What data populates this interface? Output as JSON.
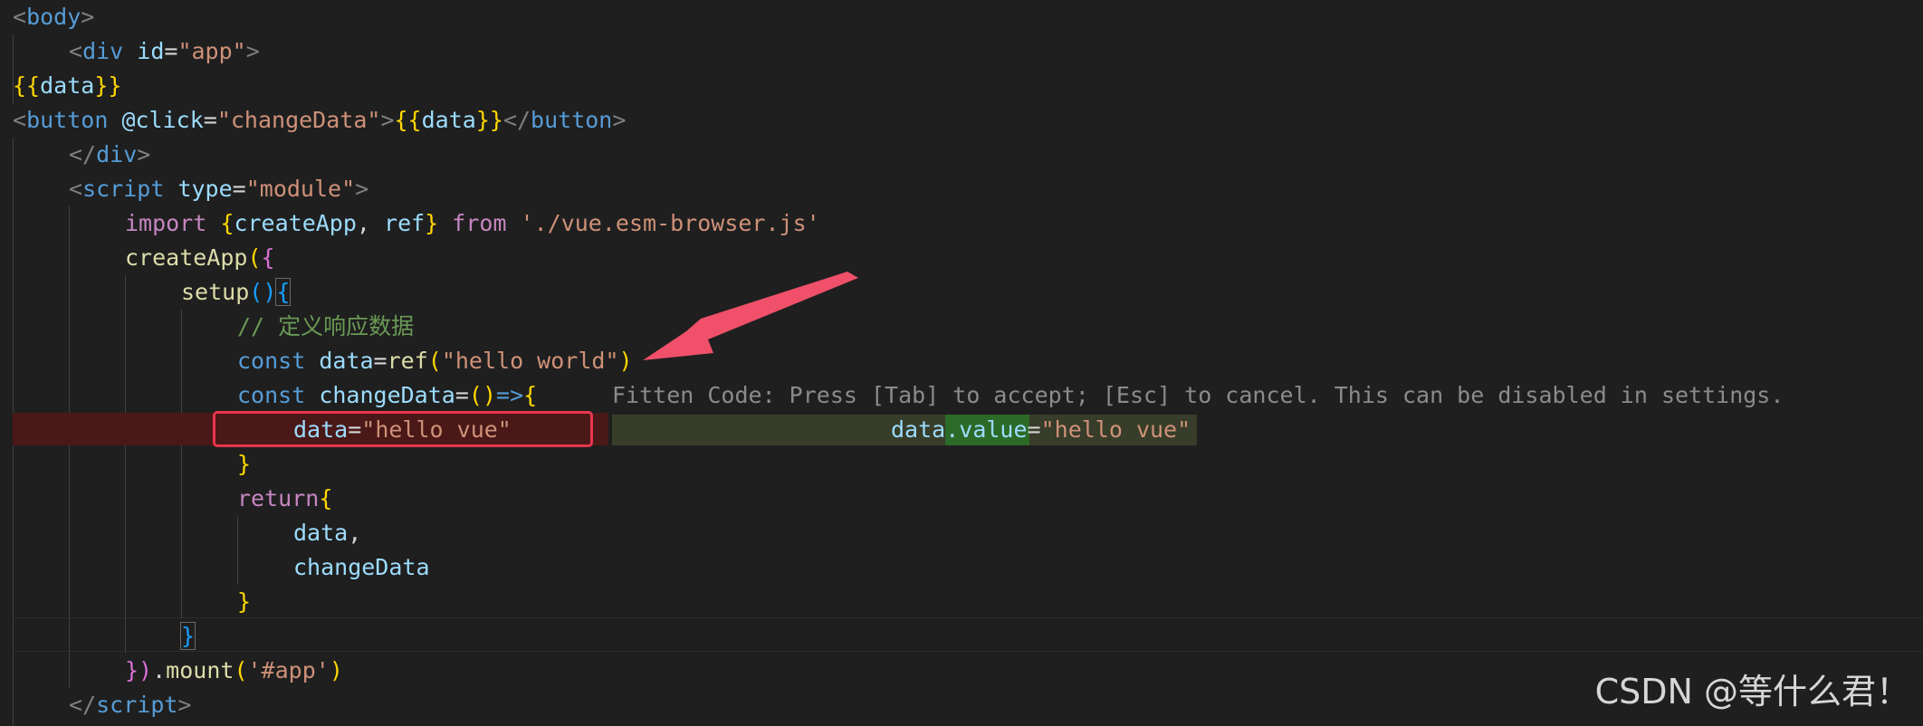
{
  "code": {
    "l1": {
      "open": "<",
      "tag": "body",
      "close": ">"
    },
    "l2": {
      "open": "<",
      "tag": "div",
      "attr": "id",
      "eq": "=",
      "val": "\"app\"",
      "close": ">"
    },
    "l3": {
      "open": "{{",
      "var": "data",
      "close": "}}"
    },
    "l4": {
      "open": "<",
      "tag": "button",
      "attr": "@click",
      "eq": "=",
      "val": "\"changeData\"",
      "gt": ">",
      "mopen": "{{",
      "var": "data",
      "mclose": "}}",
      "endopen": "</",
      "endtag": "button",
      "endclose": ">"
    },
    "l5": {
      "open": "</",
      "tag": "div",
      "close": ">"
    },
    "l6": {
      "open": "<",
      "tag": "script",
      "attr": "type",
      "eq": "=",
      "val": "\"module\"",
      "close": ">"
    },
    "l7": {
      "kw": "import",
      "sp": " ",
      "bopen": "{",
      "a": "createApp",
      "comma": ", ",
      "b": "ref",
      "bclose": "}",
      "from": " from ",
      "str": "'./vue.esm-browser.js'"
    },
    "l8": {
      "fn": "createApp",
      "popen": "(",
      "bopen": "{"
    },
    "l9": {
      "fn": "setup",
      "parens": "()",
      "bopen": "{"
    },
    "l10": {
      "comment": "// 定义响应数据"
    },
    "l11": {
      "kw": "const",
      "var": "data",
      "eq": "=",
      "fn": "ref",
      "popen": "(",
      "str": "\"hello world\"",
      "pclose": ")"
    },
    "l12": {
      "kw": "const",
      "var": "changeData",
      "eq": "=",
      "parens": "()",
      "arrow": "=>",
      "bopen": "{"
    },
    "l13": {
      "var": "data",
      "eq": "=",
      "str": "\"hello vue\""
    },
    "l14": {
      "bclose": "}"
    },
    "l15": {
      "kw": "return",
      "bopen": "{"
    },
    "l16": {
      "var": "data",
      "comma": ","
    },
    "l17": {
      "var": "changeData"
    },
    "l18": {
      "bclose": "}"
    },
    "l19": {
      "bclose": "}"
    },
    "l20": {
      "bclose": "})",
      "dot": ".",
      "fn": "mount",
      "popen": "(",
      "str": "'#app'",
      "pclose": ")"
    },
    "l21": {
      "open": "</",
      "tag": "script",
      "close": ">"
    }
  },
  "suggestion": {
    "hint": "Fitten Code: Press [Tab] to accept; [Esc] to cancel. This can be disabled in settings.",
    "var": "data",
    "added": ".value",
    "eq": "=",
    "str": "\"hello vue\""
  },
  "watermark": "CSDN @等什么君！",
  "colors": {
    "error_line": "#4b1818",
    "highlight_box": "#e8364f",
    "annotation_arrow": "#f0506a",
    "suggestion_bg": "#373d29",
    "suggestion_added": "#2c6a28"
  }
}
